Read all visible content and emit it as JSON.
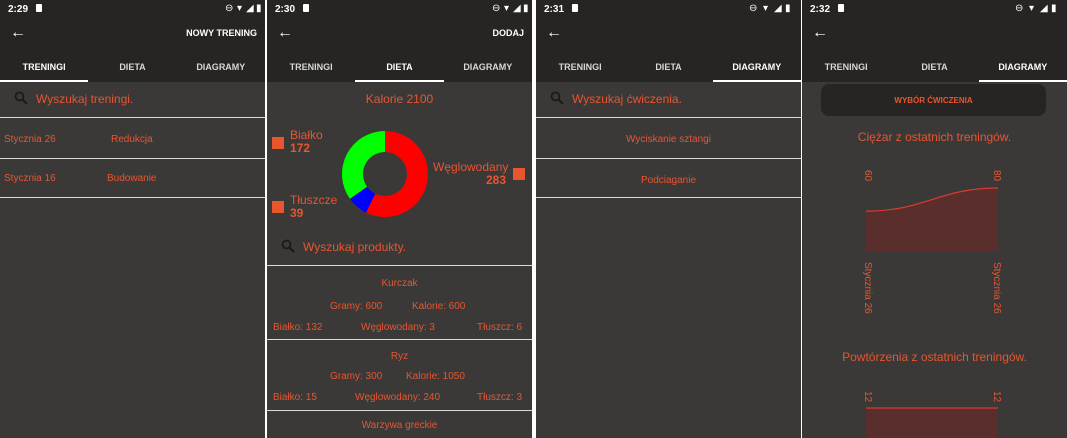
{
  "icons": {
    "back": "arrow-left-icon",
    "search": "search-icon",
    "sd": "sd-card-icon",
    "dnd": "do-not-disturb-icon",
    "wifi": "wifi-icon",
    "signal": "signal-icon",
    "battery": "battery-icon"
  },
  "colors": {
    "accent": "#e8552e",
    "background": "#3b3938",
    "bar": "#262524",
    "protein": "#00ff00",
    "fat": "#0000ff",
    "carbs": "#ff0000"
  },
  "tabs": [
    "TRENINGI",
    "DIETA",
    "DIAGRAMY"
  ],
  "screen1": {
    "time": "2:29",
    "action": "NOWY TRENING",
    "active_tab": 0,
    "search_placeholder": "Wyszukaj treningi.",
    "trainings": [
      {
        "date": "Stycznia 26",
        "name": "Redukcja"
      },
      {
        "date": "Stycznia 16",
        "name": "Budowanie"
      }
    ]
  },
  "screen2": {
    "time": "2:30",
    "action": "DODAJ",
    "active_tab": 1,
    "calories_title": "Kalorie 2100",
    "macros": {
      "protein": {
        "label": "Białko",
        "value": "172"
      },
      "fat": {
        "label": "Tłuszcze",
        "value": "39"
      },
      "carbs": {
        "label": "Węglowodany",
        "value": "283"
      }
    },
    "search_placeholder": "Wyszukaj produkty.",
    "foods": [
      {
        "name": "Kurczak",
        "grams": "Gramy: 600",
        "kcal": "Kalorie: 600",
        "protein": "Białko: 132",
        "carbs": "Węglowodany: 3",
        "fat": "Tłuszcz: 6"
      },
      {
        "name": "Ryz",
        "grams": "Gramy: 300",
        "kcal": "Kalorie: 1050",
        "protein": "Białko: 15",
        "carbs": "Węglowodany: 240",
        "fat": "Tłuszcz: 3"
      },
      {
        "name": "Warzywa greckie"
      }
    ]
  },
  "screen3": {
    "time": "2:31",
    "active_tab": 2,
    "search_placeholder": "Wyszukaj ćwiczenia.",
    "exercises": [
      "Wyciskanie sztangi",
      "Podciaganie"
    ]
  },
  "screen4": {
    "time": "2:32",
    "active_tab": 2,
    "button": "WYBÓR ĆWICZENIA"
  },
  "chart_data": [
    {
      "type": "pie",
      "title": "Kalorie 2100",
      "categories": [
        "Białko",
        "Tłuszcze",
        "Węglowodany"
      ],
      "values": [
        172,
        39,
        283
      ],
      "colors": [
        "#00ff00",
        "#0000ff",
        "#ff0000"
      ]
    },
    {
      "type": "area",
      "title": "Ciężar z ostatnich treningów.",
      "x": [
        "Stycznia 26",
        "Stycznia 26"
      ],
      "series": [
        {
          "values": [
            60,
            80
          ]
        }
      ],
      "point_labels": [
        "60",
        "80"
      ]
    },
    {
      "type": "area",
      "title": "Powtórzenia z ostatnich treningów.",
      "series": [
        {
          "values": [
            12,
            12
          ]
        }
      ],
      "point_labels": [
        "12",
        "12"
      ]
    }
  ]
}
